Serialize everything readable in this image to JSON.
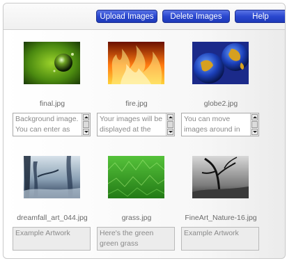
{
  "toolbar": {
    "upload_label": "Upload Images",
    "delete_label": "Delete Images",
    "help_label": "Help"
  },
  "images": [
    {
      "filename": "final.jpg",
      "description": "Background image. You can enter as",
      "thumbnail": "green-sphere-image"
    },
    {
      "filename": "fire.jpg",
      "description": "Your images will be displayed at the",
      "thumbnail": "fire-image"
    },
    {
      "filename": "globe2.jpg",
      "description": "You can move images around in",
      "thumbnail": "globe-image"
    },
    {
      "filename": "dreamfall_art_044.jpg",
      "description": "Example Artwork",
      "thumbnail": "misty-forest-image"
    },
    {
      "filename": "grass.jpg",
      "description": "Here's the green green grass",
      "thumbnail": "grass-image"
    },
    {
      "filename": "FineArt_Nature-16.jpg",
      "description": "Example Artwork",
      "thumbnail": "bare-tree-image"
    }
  ],
  "colors": {
    "button_blue": "#2a47cf",
    "caption_gray": "#6a6a6a",
    "field_text": "#8a8a8a"
  }
}
